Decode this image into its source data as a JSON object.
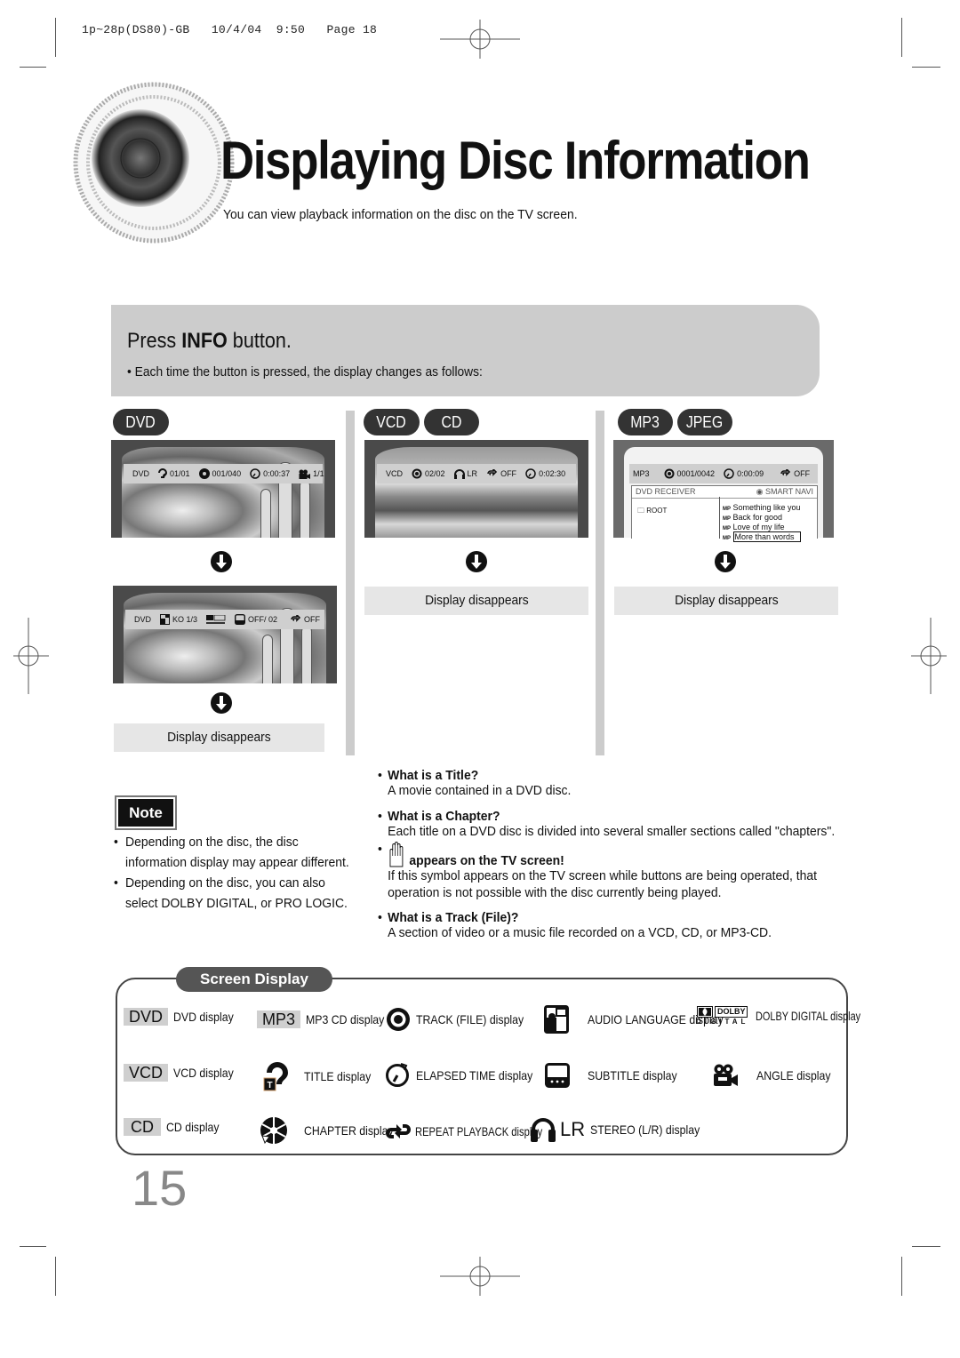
{
  "print_slug": "1p~28p(DS80)-GB   10/4/04  9:50   Page 18",
  "header": {
    "title": "Displaying Disc Information",
    "subtitle": "You can view playback information on the disc on the TV screen."
  },
  "instruction": {
    "press_prefix": "Press ",
    "press_key": "INFO",
    "press_suffix": " button.",
    "bullet": "Each time the button is pressed, the display changes as follows:"
  },
  "columns": [
    {
      "badges": [
        "DVD"
      ],
      "screens": [
        {
          "osd": [
            {
              "icon": "dvd-label",
              "text": "DVD"
            },
            {
              "icon": "title-icon",
              "text": "01/01"
            },
            {
              "icon": "chapter-icon",
              "text": "001/040"
            },
            {
              "icon": "elapsed-time-icon",
              "text": "0:00:37"
            },
            {
              "icon": "angle-icon",
              "text": "1/1"
            }
          ]
        },
        {
          "osd": [
            {
              "icon": "dvd-label",
              "text": "DVD"
            },
            {
              "icon": "audio-language-icon",
              "text": "KO 1/3"
            },
            {
              "icon": "dolby-digital-icon",
              "text": ""
            },
            {
              "icon": "subtitle-icon",
              "text": "OFF/ 02"
            },
            {
              "icon": "repeat-icon",
              "text": "OFF"
            }
          ]
        }
      ],
      "final": "Display disappears"
    },
    {
      "badges": [
        "VCD",
        "CD"
      ],
      "screens": [
        {
          "osd": [
            {
              "icon": "vcd-label",
              "text": "VCD"
            },
            {
              "icon": "track-icon",
              "text": "02/02"
            },
            {
              "icon": "stereo-icon",
              "text": "LR"
            },
            {
              "icon": "repeat-icon",
              "text": "OFF"
            },
            {
              "icon": "elapsed-time-icon",
              "text": "0:02:30"
            }
          ]
        }
      ],
      "final": "Display disappears"
    },
    {
      "badges": [
        "MP3",
        "JPEG"
      ],
      "screens": [
        {
          "osd": [
            {
              "icon": "mp3-label",
              "text": "MP3"
            },
            {
              "icon": "track-icon",
              "text": "0001/0042"
            },
            {
              "icon": "elapsed-time-icon",
              "text": "0:00:09"
            },
            {
              "icon": "repeat-icon",
              "text": "OFF"
            }
          ],
          "navigator": {
            "header_left": "DVD RECEIVER",
            "header_right": "SMART NAVI",
            "folder": "ROOT",
            "files": [
              "Something like you",
              "Back for good",
              "Love of my life",
              "More than words"
            ],
            "selected_index": 3
          }
        }
      ],
      "final": "Display disappears"
    }
  ],
  "note": {
    "label": "Note",
    "items": [
      [
        "Depending on the disc, the disc",
        "information display may appear different."
      ],
      [
        "Depending on the disc, you can also",
        "select DOLBY DIGITAL, or PRO LOGIC."
      ]
    ]
  },
  "faq": [
    {
      "q": "What is a Title?",
      "a": [
        "A movie contained in a DVD disc."
      ]
    },
    {
      "q": "What is a Chapter?",
      "a": [
        "Each title on a DVD disc is divided into several smaller sections called \"chapters\"."
      ]
    },
    {
      "q": "appears on the TV screen!",
      "icon": "hand-icon",
      "a": [
        "If this symbol appears on the TV screen while buttons are being operated, that",
        "operation is not possible with the disc currently being played."
      ]
    },
    {
      "q": "What is a Track (File)?",
      "a": [
        "A section of video or a music file recorded on a VCD, CD, or MP3-CD."
      ]
    }
  ],
  "screen_display": {
    "title": "Screen Display",
    "items": [
      {
        "icon": "DVD",
        "label": "DVD display"
      },
      {
        "icon": "MP3",
        "label": "MP3 CD display"
      },
      {
        "icon": "track-icon",
        "label": "TRACK (FILE) display"
      },
      {
        "icon": "audio-language-icon",
        "label": "AUDIO LANGUAGE display"
      },
      {
        "icon": "dolby-digital-icon",
        "label": "DOLBY DIGITAL display"
      },
      {
        "icon": "VCD",
        "label": "VCD display"
      },
      {
        "icon": "title-icon",
        "label": "TITLE display"
      },
      {
        "icon": "elapsed-time-icon",
        "label": "ELAPSED TIME display"
      },
      {
        "icon": "subtitle-icon",
        "label": "SUBTITLE display"
      },
      {
        "icon": "angle-icon",
        "label": "ANGLE display"
      },
      {
        "icon": "CD",
        "label": "CD display"
      },
      {
        "icon": "chapter-icon",
        "label": "CHAPTER display"
      },
      {
        "icon": "repeat-icon",
        "label": "REPEAT PLAYBACK display"
      },
      {
        "icon": "stereo-icon",
        "text": "LR",
        "label": "STEREO (L/R) display"
      }
    ],
    "dolby_text_top": "DOLBY",
    "dolby_text_bottom": "DIGITAL"
  },
  "page_number": "15"
}
